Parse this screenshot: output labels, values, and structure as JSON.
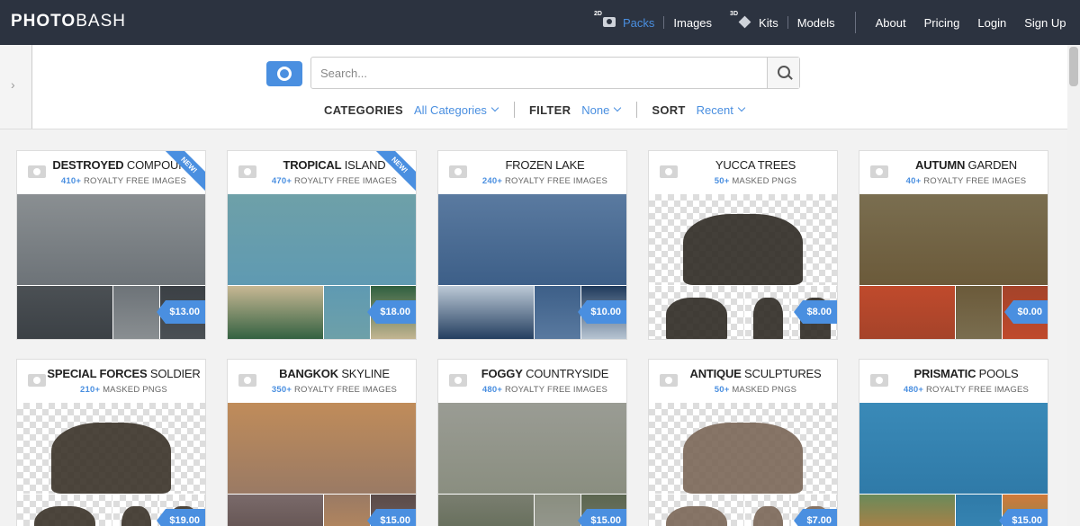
{
  "brand": {
    "bold": "PHOTO",
    "rest": "BASH"
  },
  "nav": {
    "packs_tag": "2D",
    "packs": "Packs",
    "images": "Images",
    "kits_tag": "3D",
    "kits": "Kits",
    "models": "Models",
    "about": "About",
    "pricing": "Pricing",
    "login": "Login",
    "signup": "Sign Up"
  },
  "search": {
    "placeholder": "Search..."
  },
  "filters": {
    "categories_label": "CATEGORIES",
    "categories_value": "All Categories",
    "filter_label": "FILTER",
    "filter_value": "None",
    "sort_label": "SORT",
    "sort_value": "Recent"
  },
  "new_label": "NEW!",
  "packs": [
    {
      "title_bold": "DESTROYED",
      "title_rest": " COMPOUND",
      "count": "410+",
      "desc": " ROYALTY FREE IMAGES",
      "price": "$13.00",
      "new": true,
      "colors": [
        "#6d7378",
        "#3b4045",
        "#8a8f92",
        "#4b5054"
      ],
      "masked": false
    },
    {
      "title_bold": "TROPICAL",
      "title_rest": " ISLAND",
      "count": "470+",
      "desc": " ROYALTY FREE IMAGES",
      "price": "$18.00",
      "new": true,
      "colors": [
        "#5f9ab2",
        "#2f5f3f",
        "#6ea0a8",
        "#c8b894"
      ],
      "masked": false
    },
    {
      "title_bold": "",
      "title_rest": "FROZEN LAKE",
      "count": "240+",
      "desc": " ROYALTY FREE IMAGES",
      "price": "$10.00",
      "new": false,
      "colors": [
        "#3d5f88",
        "#1f3a5c",
        "#5a7aa0",
        "#bcc9d6"
      ],
      "masked": false
    },
    {
      "title_bold": "",
      "title_rest": "YUCCA TREES",
      "count": "50+",
      "desc": " MASKED PNGS",
      "price": "$8.00",
      "new": false,
      "colors": [
        "#2f2a24",
        "#2f2a24",
        "#2f2a24",
        "#2f2a24"
      ],
      "masked": true
    },
    {
      "title_bold": "AUTUMN",
      "title_rest": " GARDEN",
      "count": "40+",
      "desc": " ROYALTY FREE IMAGES",
      "price": "$0.00",
      "new": false,
      "colors": [
        "#6b5a3a",
        "#a4432a",
        "#7a6e50",
        "#c04a2c"
      ],
      "masked": false
    },
    {
      "title_bold": "SPECIAL FORCES",
      "title_rest": " SOLDIER",
      "count": "210+",
      "desc": " MASKED PNGS",
      "price": "$19.00",
      "new": false,
      "colors": [
        "#3a3228",
        "#3a3228",
        "#3a3228",
        "#3a3228"
      ],
      "masked": true
    },
    {
      "title_bold": "BANGKOK",
      "title_rest": " SKYLINE",
      "count": "350+",
      "desc": " ROYALTY FREE IMAGES",
      "price": "$15.00",
      "new": false,
      "colors": [
        "#9a7a64",
        "#5a4a48",
        "#c08c5a",
        "#7a6a6a"
      ],
      "masked": false
    },
    {
      "title_bold": "FOGGY",
      "title_rest": " COUNTRYSIDE",
      "count": "480+",
      "desc": " ROYALTY FREE IMAGES",
      "price": "$15.00",
      "new": false,
      "colors": [
        "#8a8e80",
        "#5c6650",
        "#9a9c94",
        "#7a7e70"
      ],
      "masked": false
    },
    {
      "title_bold": "ANTIQUE",
      "title_rest": " SCULPTURES",
      "count": "50+",
      "desc": " MASKED PNGS",
      "price": "$7.00",
      "new": false,
      "colors": [
        "#7a6656",
        "#7a6656",
        "#7a6656",
        "#7a6656"
      ],
      "masked": true
    },
    {
      "title_bold": "PRISMATIC",
      "title_rest": " POOLS",
      "count": "480+",
      "desc": " ROYALTY FREE IMAGES",
      "price": "$15.00",
      "new": false,
      "colors": [
        "#2f7aa8",
        "#d07a3a",
        "#3a8ab8",
        "#6a8a5a"
      ],
      "masked": false
    }
  ]
}
